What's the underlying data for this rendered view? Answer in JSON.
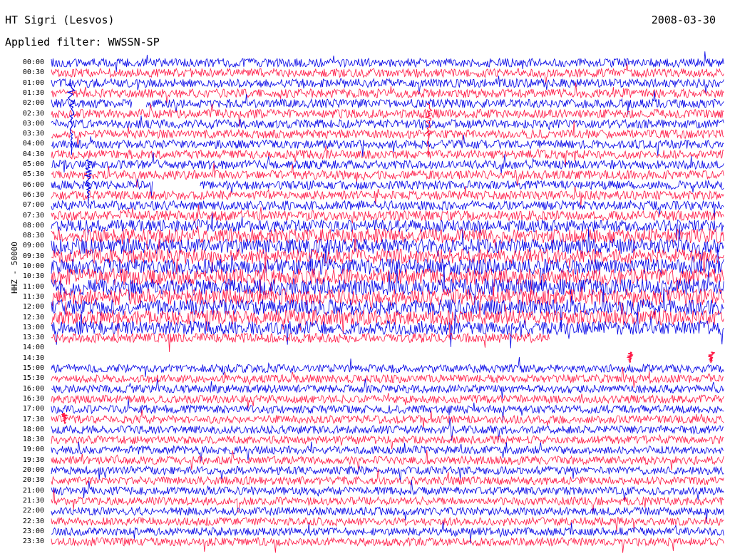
{
  "header": {
    "station": "HT Sigri (Lesvos)",
    "date": "2008-03-30",
    "filter": "Applied filter: WWSSN-SP"
  },
  "chart_data": {
    "type": "line",
    "title": "HT Sigri (Lesvos)",
    "ylabel": "HHZ - 50000",
    "xlabel": "",
    "colors": {
      "trace_a": "#0000e6",
      "trace_b": "#ff1744",
      "background": "#ffffff"
    },
    "trace_color_order": [
      "trace_a",
      "trace_b"
    ],
    "row_labels": [
      "00:00",
      "00:30",
      "01:00",
      "01:30",
      "02:00",
      "02:30",
      "03:00",
      "03:30",
      "04:00",
      "04:30",
      "05:00",
      "05:30",
      "06:00",
      "06:30",
      "07:00",
      "07:30",
      "08:00",
      "08:30",
      "09:00",
      "09:30",
      "10:00",
      "10:30",
      "11:00",
      "11:30",
      "12:00",
      "12:30",
      "13:00",
      "13:30",
      "14:00",
      "14:30",
      "15:00",
      "15:30",
      "16:00",
      "16:30",
      "17:00",
      "17:30",
      "18:00",
      "18:30",
      "19:00",
      "19:30",
      "20:00",
      "20:30",
      "21:00",
      "21:30",
      "22:00",
      "22:30",
      "23:00",
      "23:30"
    ],
    "row_noise_level": [
      0.35,
      0.35,
      0.35,
      0.35,
      0.35,
      0.35,
      0.35,
      0.35,
      0.35,
      0.35,
      0.35,
      0.35,
      0.35,
      0.35,
      0.4,
      0.45,
      0.6,
      0.8,
      0.85,
      0.85,
      0.9,
      0.95,
      0.95,
      0.95,
      0.9,
      0.85,
      0.75,
      0.4,
      0,
      0,
      0.3,
      0.3,
      0.3,
      0.3,
      0.3,
      0.3,
      0.3,
      0.3,
      0.3,
      0.3,
      0.3,
      0.3,
      0.3,
      0.3,
      0.3,
      0.3,
      0.3,
      0.3
    ],
    "data_gaps": [
      {
        "row": "02:00",
        "start_frac": 0.12,
        "end_frac": 0.14
      },
      {
        "row": "06:00",
        "start_frac": 0.15,
        "end_frac": 0.22
      },
      {
        "row": "13:30",
        "start_frac": 0.74,
        "end_frac": 1.0
      },
      {
        "row": "14:00",
        "start_frac": 0.0,
        "end_frac": 1.0
      },
      {
        "row": "14:30",
        "start_frac": 0.0,
        "end_frac": 1.0
      }
    ],
    "events": [
      {
        "row": "03:00",
        "x_frac": 0.03,
        "amplitude": 4.0
      },
      {
        "row": "06:00",
        "x_frac": 0.055,
        "amplitude": 2.5
      },
      {
        "row": "03:30",
        "x_frac": 0.56,
        "amplitude": 3.0
      },
      {
        "row": "14:30",
        "x_frac": 0.86,
        "amplitude": 0.6
      },
      {
        "row": "14:30",
        "x_frac": 0.98,
        "amplitude": 0.6
      },
      {
        "row": "17:30",
        "x_frac": 0.02,
        "amplitude": 0.6
      }
    ]
  }
}
